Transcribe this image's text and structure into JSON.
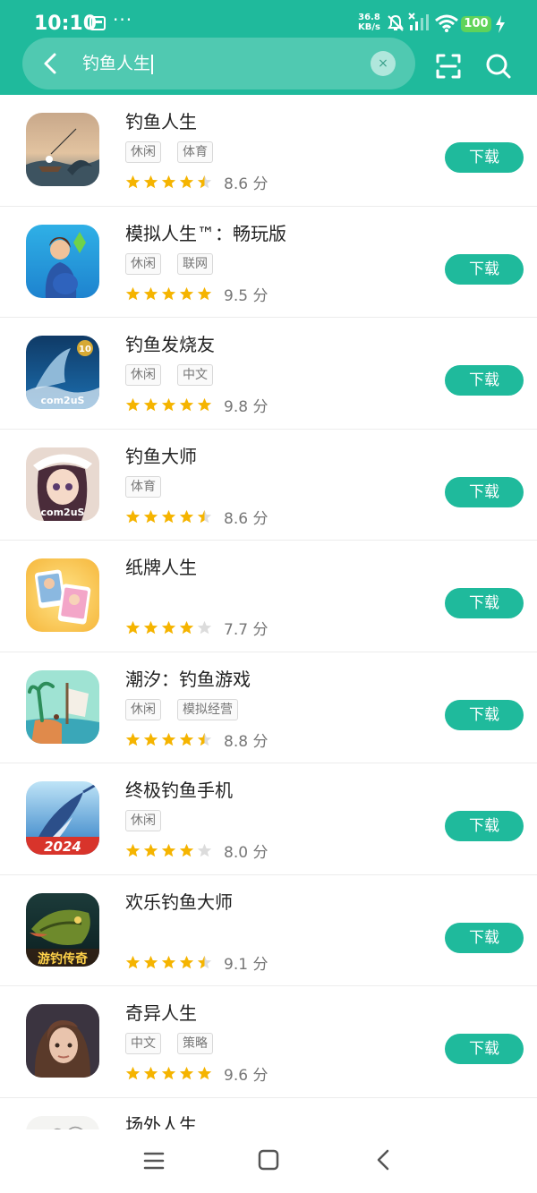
{
  "status": {
    "time": "10:10",
    "dots": "···",
    "speed_value": "36.8",
    "speed_unit": "KB/s",
    "battery": "100"
  },
  "search": {
    "query": "钓鱼人生",
    "clear_label": "×"
  },
  "colors": {
    "brand": "#1fba9c",
    "star": "#f5b400",
    "star_empty": "#dcdcdc"
  },
  "apps": [
    {
      "name": "钓鱼人生",
      "tags": [
        "休闲",
        "体育"
      ],
      "stars": 4.5,
      "score": "8.6 分",
      "button": "下载"
    },
    {
      "name": "模拟人生™：畅玩版",
      "tags": [
        "休闲",
        "联网"
      ],
      "stars": 5,
      "score": "9.5 分",
      "button": "下载"
    },
    {
      "name": "钓鱼发烧友",
      "tags": [
        "休闲",
        "中文"
      ],
      "stars": 5,
      "score": "9.8 分",
      "button": "下载"
    },
    {
      "name": "钓鱼大师",
      "tags": [
        "体育"
      ],
      "stars": 4.5,
      "score": "8.6 分",
      "button": "下载"
    },
    {
      "name": "纸牌人生",
      "tags": [],
      "stars": 4,
      "score": "7.7 分",
      "button": "下载"
    },
    {
      "name": "潮汐：钓鱼游戏",
      "tags": [
        "休闲",
        "模拟经营"
      ],
      "stars": 4.5,
      "score": "8.8 分",
      "button": "下载"
    },
    {
      "name": "终极钓鱼手机",
      "tags": [
        "休闲"
      ],
      "stars": 4,
      "score": "8.0 分",
      "button": "下载"
    },
    {
      "name": "欢乐钓鱼大师",
      "tags": [],
      "stars": 4.5,
      "score": "9.1 分",
      "button": "下载"
    },
    {
      "name": "奇异人生",
      "tags": [
        "中文",
        "策略"
      ],
      "stars": 5,
      "score": "9.6 分",
      "button": "下载"
    },
    {
      "name": "场外人生",
      "tags": [],
      "stars": 0,
      "score": "",
      "button": ""
    }
  ],
  "icon_labels": {
    "app3": "com2uS",
    "app4": "com2uS",
    "app7": "2024",
    "app8": "游钓传奇"
  }
}
